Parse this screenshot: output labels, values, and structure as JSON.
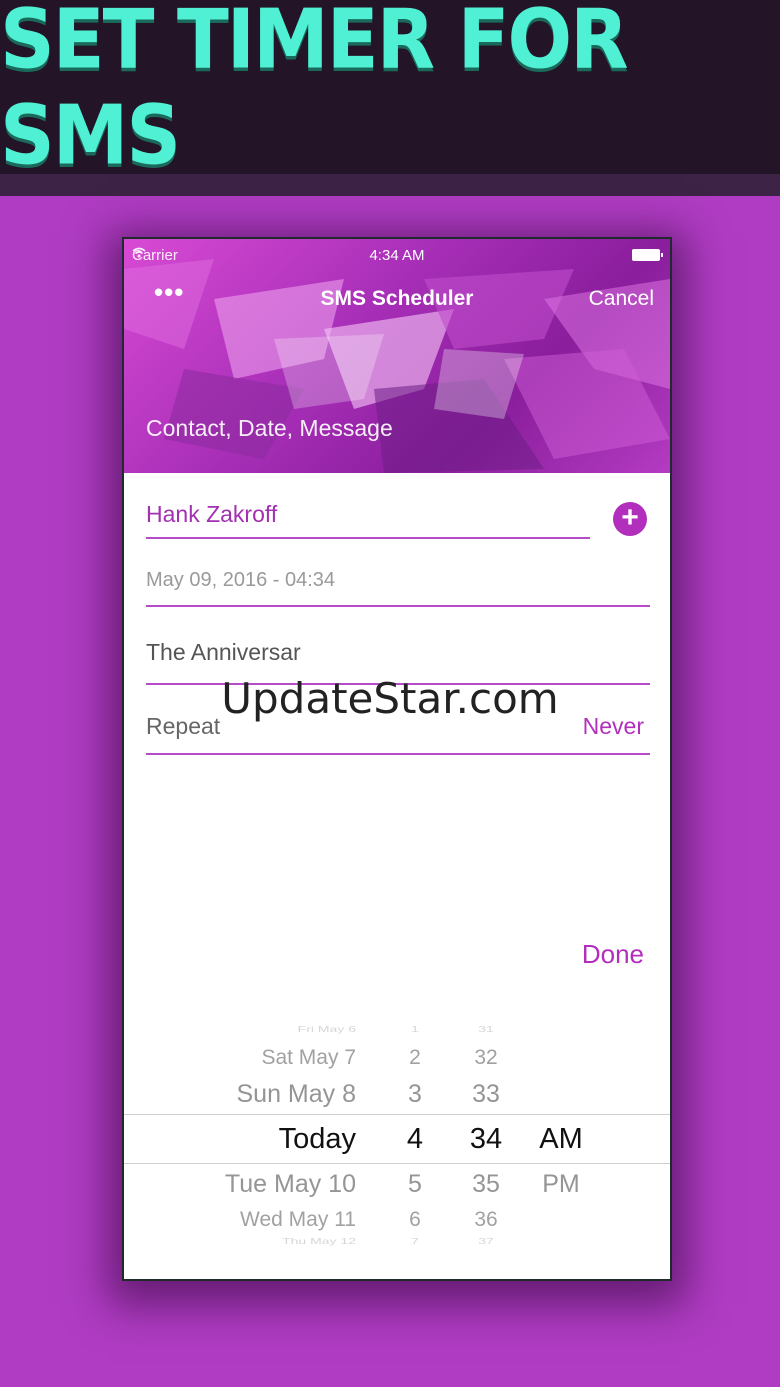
{
  "banner": {
    "title": "SET TIMER FOR SMS"
  },
  "status_bar": {
    "carrier": "Carrier",
    "time": "4:34 AM"
  },
  "nav": {
    "more": "•••",
    "title": "SMS Scheduler",
    "cancel": "Cancel"
  },
  "hero": {
    "caption": "Contact, Date, Message"
  },
  "form": {
    "contact": "Hank Zakroff",
    "add_symbol": "+",
    "datetime": "May 09, 2016 - 04:34",
    "message": "The Anniversar",
    "repeat_label": "Repeat",
    "repeat_value": "Never"
  },
  "watermark": "UpdateStar.com",
  "done": "Done",
  "picker": {
    "rows": [
      {
        "day": "Fri May 6",
        "hour": "1",
        "minute": "31",
        "ampm": ""
      },
      {
        "day": "Sat May 7",
        "hour": "2",
        "minute": "32",
        "ampm": ""
      },
      {
        "day": "Sun May 8",
        "hour": "3",
        "minute": "33",
        "ampm": ""
      },
      {
        "day": "Today",
        "hour": "4",
        "minute": "34",
        "ampm": "AM"
      },
      {
        "day": "Tue May 10",
        "hour": "5",
        "minute": "35",
        "ampm": "PM"
      },
      {
        "day": "Wed May 11",
        "hour": "6",
        "minute": "36",
        "ampm": ""
      },
      {
        "day": "Thu May 12",
        "hour": "7",
        "minute": "37",
        "ampm": ""
      }
    ]
  },
  "colors": {
    "accent": "#b22fbd",
    "background": "#b03cc3",
    "banner_text": "#4ff0d4",
    "banner_bg": "#241428"
  }
}
